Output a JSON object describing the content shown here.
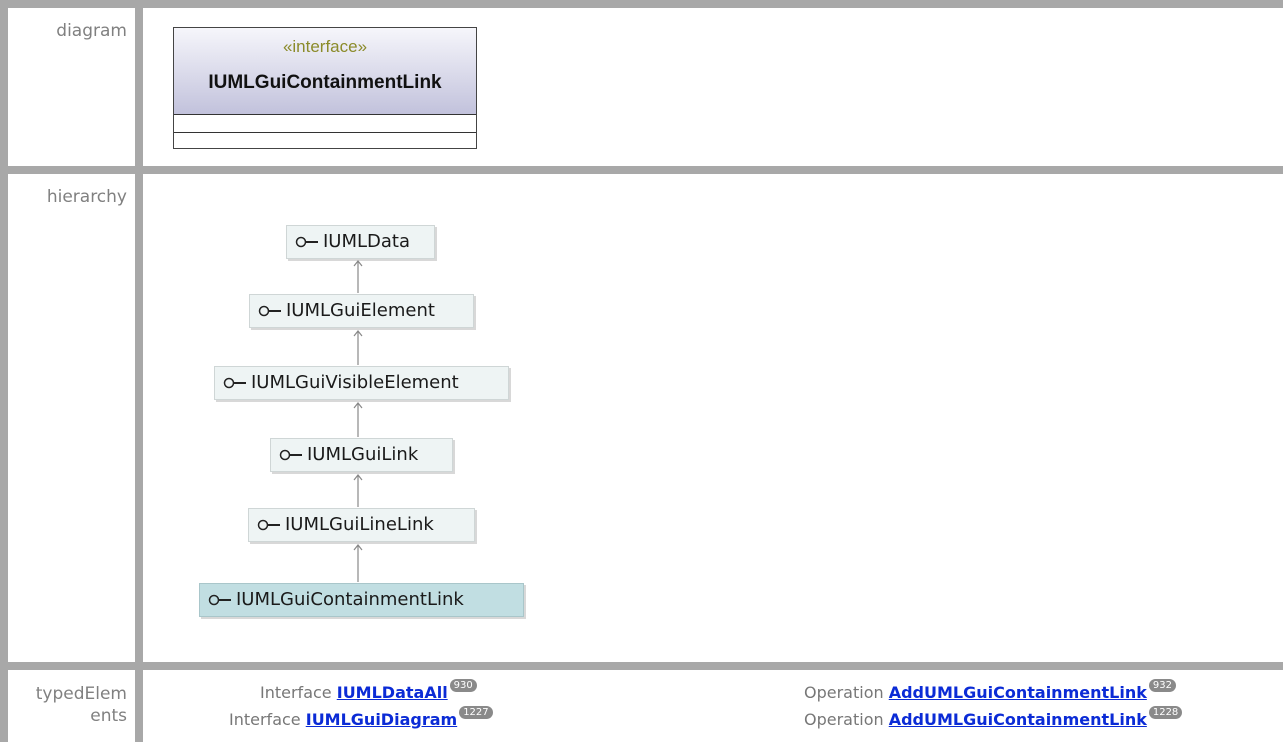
{
  "rows": {
    "diagram": "diagram",
    "hierarchy": "hierarchy",
    "typed_line1": "typedElem",
    "typed_line2": "ents"
  },
  "diagram": {
    "stereotype": "«interface»",
    "name": "IUMLGuiContainmentLink"
  },
  "hierarchy": {
    "nodes": [
      "IUMLData",
      "IUMLGuiElement",
      "IUMLGuiVisibleElement",
      "IUMLGuiLink",
      "IUMLGuiLineLink",
      "IUMLGuiContainmentLink"
    ],
    "selected": "IUMLGuiContainmentLink"
  },
  "typed_elements": [
    {
      "kind": "Interface",
      "name": "IUMLDataAll",
      "page": "930"
    },
    {
      "kind": "Operation",
      "name": "AddUMLGuiContainmentLink",
      "page": "932"
    },
    {
      "kind": "Interface",
      "name": "IUMLGuiDiagram",
      "page": "1227"
    },
    {
      "kind": "Operation",
      "name": "AddUMLGuiContainmentLink",
      "page": "1228"
    }
  ],
  "colors": {
    "link": "#0b2bd6",
    "selected_node": "#c1dee2",
    "node": "#eef4f4",
    "stereotype": "#8b8b2a"
  }
}
